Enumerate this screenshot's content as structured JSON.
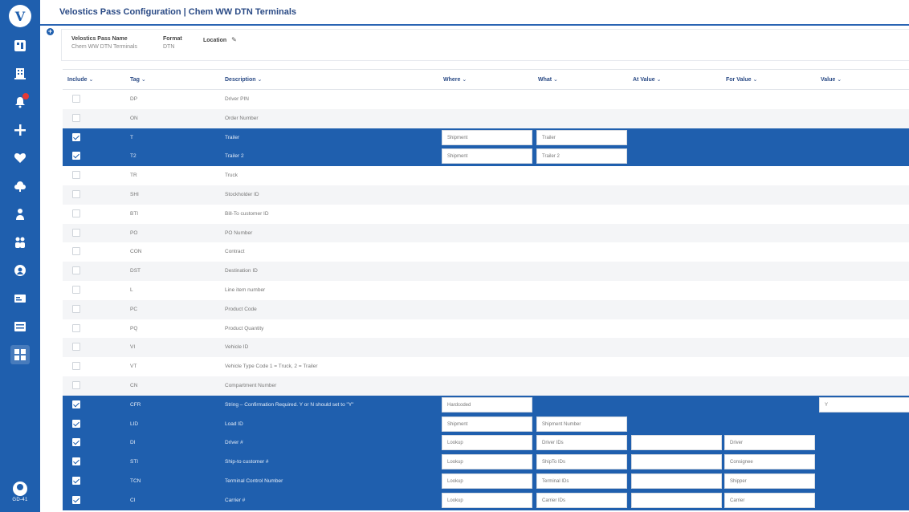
{
  "header": {
    "title": "Velostics Pass Configuration | Chem WW DTN Terminals"
  },
  "sidebar": {
    "logo": "V",
    "icons": [
      "dashboard-icon",
      "building-icon",
      "notification-icon",
      "plus-icon",
      "heart-icon",
      "cloud-icon",
      "person-icon",
      "users-icon",
      "badge-icon",
      "card-icon",
      "list-icon",
      "grid-icon"
    ],
    "badge": "",
    "user_initials": "GD-41"
  },
  "info": {
    "pass_name_label": "Velostics Pass Name",
    "pass_name_value": "Chem WW DTN Terminals",
    "format_label": "Format",
    "format_value": "DTN",
    "location_label": "Location"
  },
  "table": {
    "columns": [
      "Include",
      "Tag",
      "Description",
      "Where",
      "What",
      "At Value",
      "For Value",
      "Value"
    ],
    "rows": [
      {
        "include": false,
        "tag": "DP",
        "description": "Driver PIN"
      },
      {
        "include": false,
        "tag": "ON",
        "description": "Order Number"
      },
      {
        "include": true,
        "tag": "T",
        "description": "Trailer",
        "where": "Shipment",
        "what": "Trailer"
      },
      {
        "include": true,
        "tag": "T2",
        "description": "Trailer 2",
        "where": "Shipment",
        "what": "Trailer 2"
      },
      {
        "include": false,
        "tag": "TR",
        "description": "Truck"
      },
      {
        "include": false,
        "tag": "SHI",
        "description": "Stockholder ID"
      },
      {
        "include": false,
        "tag": "BTI",
        "description": "Bill-To customer ID"
      },
      {
        "include": false,
        "tag": "PO",
        "description": "PO Number"
      },
      {
        "include": false,
        "tag": "CON",
        "description": "Contract"
      },
      {
        "include": false,
        "tag": "DST",
        "description": "Destination ID"
      },
      {
        "include": false,
        "tag": "L",
        "description": "Line item number"
      },
      {
        "include": false,
        "tag": "PC",
        "description": "Product Code"
      },
      {
        "include": false,
        "tag": "PQ",
        "description": "Product Quantity"
      },
      {
        "include": false,
        "tag": "VI",
        "description": "Vehicle ID"
      },
      {
        "include": false,
        "tag": "VT",
        "description": "Vehicle Type Code 1 = Truck, 2 = Trailer"
      },
      {
        "include": false,
        "tag": "CN",
        "description": "Compartment Number"
      },
      {
        "include": true,
        "tag": "CFR",
        "description": "String – Confirmation Required. Y or N should set to \"Y\"",
        "where": "Hardcoded",
        "value": "Y"
      },
      {
        "include": true,
        "tag": "LID",
        "description": "Load ID",
        "where": "Shipment",
        "what": "Shipment Number"
      },
      {
        "include": true,
        "tag": "DI",
        "description": "Driver #",
        "where": "Lookup",
        "what": "Driver IDs",
        "at_value": "",
        "for_value": "Driver"
      },
      {
        "include": true,
        "tag": "STI",
        "description": "Ship-to customer #",
        "where": "Lookup",
        "what": "ShipTo IDs",
        "at_value": "",
        "for_value": "Consignee"
      },
      {
        "include": true,
        "tag": "TCN",
        "description": "Terminal Control Number",
        "where": "Lookup",
        "what": "Terminal IDs",
        "at_value": "",
        "for_value": "Shipper"
      },
      {
        "include": true,
        "tag": "CI",
        "description": "Carrier #",
        "where": "Lookup",
        "what": "Carrier IDs",
        "at_value": "",
        "for_value": "Carrier"
      }
    ]
  }
}
